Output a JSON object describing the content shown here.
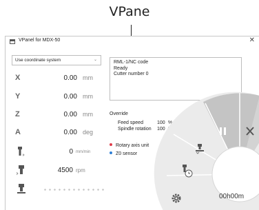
{
  "caption": "VPane",
  "window": {
    "title": "VPanel for MDX-50",
    "close_glyph": "✕"
  },
  "coordinate_system": {
    "selected": "Use coordinate system"
  },
  "axes": [
    {
      "label": "X",
      "value": "0.00",
      "unit": "mm"
    },
    {
      "label": "Y",
      "value": "0.00",
      "unit": "mm"
    },
    {
      "label": "Z",
      "value": "0.00",
      "unit": "mm"
    },
    {
      "label": "A",
      "value": "0.00",
      "unit": "deg"
    }
  ],
  "tools": [
    {
      "name": "feed-rate",
      "value": "0",
      "unit": "mm/min"
    },
    {
      "name": "spindle",
      "value": "4500",
      "unit": "rpm"
    },
    {
      "name": "spindle-load"
    }
  ],
  "status": {
    "lines": [
      "RML-1/NC code",
      "Ready",
      "Cutter number 0"
    ]
  },
  "override": {
    "title": "Override",
    "rows": [
      {
        "label": "Feed speed",
        "value": "100",
        "unit": "%"
      },
      {
        "label": "Spindle rotation",
        "value": "100",
        "unit": "%"
      }
    ]
  },
  "indicators": [
    {
      "label": "Rotary axis unit",
      "color": "#e03c4a"
    },
    {
      "label": "Z0 sensor",
      "color": "#2e7fd6"
    }
  ],
  "controls": {
    "pause_icon": "pause-icon",
    "stop_icon": "stop-icon",
    "timer": "00h00m"
  },
  "colors": {
    "ring": "#eaeaea",
    "ring_active": "#c5c5c5",
    "dark_icon": "#555555"
  }
}
